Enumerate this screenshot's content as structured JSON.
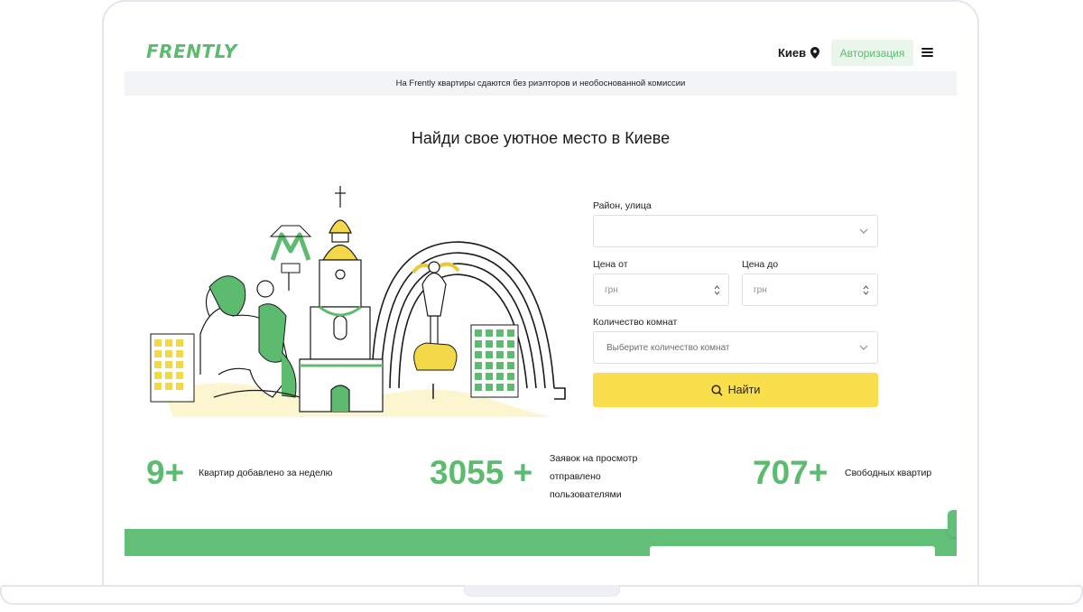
{
  "header": {
    "logo": "FRENTLY",
    "city": "Киев",
    "auth_label": "Авторизация"
  },
  "banner": "На Frently квартиры сдаются без риэлторов и необоснованной комиссии",
  "hero": {
    "title": "Найди свое уютное место в Киеве"
  },
  "search_form": {
    "district_label": "Район, улица",
    "district_value": "",
    "price_from_label": "Цена от",
    "price_from_placeholder": "грн",
    "price_to_label": "Цена до",
    "price_to_placeholder": "грн",
    "rooms_label": "Количество комнат",
    "rooms_placeholder": "Выберите количество комнат",
    "submit_label": "Найти"
  },
  "stats": [
    {
      "value": "9+",
      "text": "Квартир добавлено за неделю"
    },
    {
      "value": "3055 +",
      "text_lines": [
        "Заявок на просмотр",
        "отправлено",
        "пользователями"
      ]
    },
    {
      "value": "707+",
      "text": "Свободных квартир"
    }
  ],
  "colors": {
    "brand_green": "#5cbb6f",
    "button_yellow": "#f9df4b",
    "auth_bg": "#eaf5ec"
  }
}
